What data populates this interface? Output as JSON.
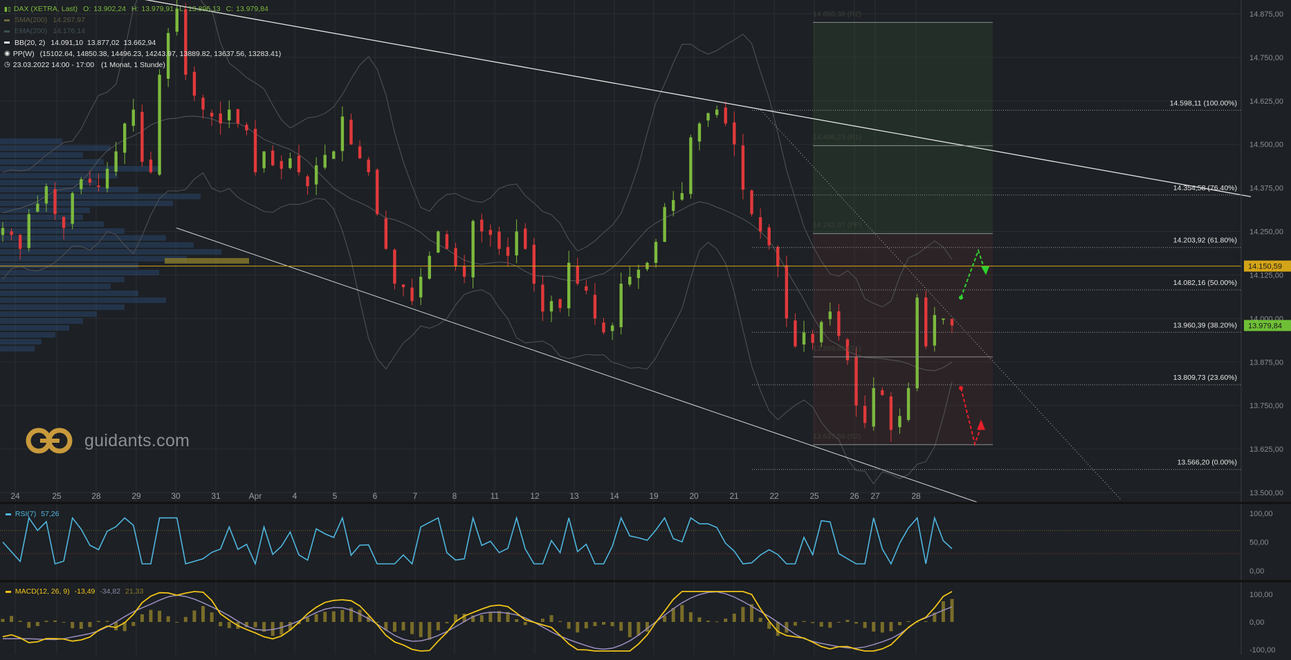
{
  "header": {
    "instrument_line": "DAX (XETRA, Last)",
    "ohlc": {
      "o_label": "O:",
      "o": "13.902,24",
      "h_label": "H:",
      "h": "13.979,91",
      "l_label": "L:",
      "l": "13.896,13",
      "c_label": "C:",
      "c": "13.979,84"
    },
    "sma": {
      "label": "SMA(200)",
      "value": "14.267,97"
    },
    "ema": {
      "label": "EMA(200)",
      "value": "14.176,14"
    },
    "bb": {
      "label": "BB(20, 2)",
      "values": "14.091,10  13.877,02  13.662,94"
    },
    "pp": {
      "label": "PP(W)",
      "values": "(15102.64, 14850.38, 14496.23, 14243.97, 13889.82, 13637.56, 13283.41)"
    },
    "time": {
      "label": "23.03.2022 14:00 - 17:00",
      "period": "(1 Monat, 1 Stunde)"
    }
  },
  "watermark": {
    "text": "guidants.com"
  },
  "colors": {
    "background": "#1d2024",
    "up": "#7cb93e",
    "down": "#e0393b",
    "line": "#e6e6e6",
    "price_line": "#d4a418",
    "current": "#6fbf36",
    "rsi": "#4fb6e0",
    "macd": "#f0c419",
    "signal": "#9b8fc2",
    "hist": "#8a7a2a",
    "target_up": "#2fd12f",
    "target_down": "#e8202a"
  },
  "main_axis": {
    "ticks": [
      "14.875,00",
      "14.750,00",
      "14.625,00",
      "14.500,00",
      "14.375,00",
      "14.250,00",
      "14.125,00",
      "14.000,00",
      "13.875,00",
      "13.750,00",
      "13.625,00",
      "13.500,00"
    ],
    "price_tag": "14.150,59",
    "last_tag": "13.979,84"
  },
  "x_axis_labels": [
    "24",
    "25",
    "28",
    "29",
    "30",
    "31",
    "Apr",
    "4",
    "5",
    "6",
    "7",
    "8",
    "11",
    "12",
    "13",
    "14",
    "19",
    "20",
    "21",
    "22",
    "25",
    "26",
    "27",
    "28"
  ],
  "fibonacci": [
    {
      "label": "14.598,11 (100.00%)",
      "value": 14598.11
    },
    {
      "label": "14.354,58 (76.40%)",
      "value": 14354.58
    },
    {
      "label": "14.203,92 (61.80%)",
      "value": 14203.92
    },
    {
      "label": "14.082,16 (50.00%)",
      "value": 14082.16
    },
    {
      "label": "13.960,39 (38.20%)",
      "value": 13960.39
    },
    {
      "label": "13.809,73 (23.60%)",
      "value": 13809.73
    },
    {
      "label": "13.566,20 (0.00%)",
      "value": 13566.2
    }
  ],
  "pivots": [
    {
      "label": "14.850,38 (R2)",
      "value": 14850.38
    },
    {
      "label": "14.496,23 (R1)",
      "value": 14496.23
    },
    {
      "label": "14.243,97 (PP)",
      "value": 14243.97
    },
    {
      "label": "13.889,82 (S1)",
      "value": 13889.82
    },
    {
      "label": "13.637,56 (S2)",
      "value": 13637.56
    }
  ],
  "rsi": {
    "label": "RSI(7)",
    "value": "57,26",
    "ticks": [
      "100,00",
      "50,00",
      "0,00"
    ],
    "upper": 70,
    "lower": 30
  },
  "macd": {
    "label": "MACD(12, 26, 9)",
    "macd": "-13,49",
    "signal": "-34,82",
    "hist": "21,33",
    "ticks": [
      "100,00",
      "0,00",
      "-100,00"
    ]
  },
  "chart_data": {
    "type": "candlestick",
    "title": "DAX (XETRA, Last)",
    "interval": "1 hour",
    "y_range": [
      13480,
      14925
    ],
    "x_session_labels": [
      "24",
      "25",
      "28",
      "29",
      "30",
      "31",
      "Apr",
      "4",
      "5",
      "6",
      "7",
      "8",
      "11",
      "12",
      "13",
      "14",
      "19",
      "20",
      "21",
      "22",
      "25",
      "26",
      "27",
      "28"
    ],
    "close_path": [
      14260,
      14240,
      14200,
      14300,
      14330,
      14380,
      14300,
      14260,
      14360,
      14400,
      14390,
      14380,
      14430,
      14480,
      14560,
      14600,
      14450,
      14420,
      14700,
      14820,
      14890,
      14700,
      14640,
      14600,
      14580,
      14560,
      14600,
      14560,
      14540,
      14420,
      14480,
      14440,
      14430,
      14460,
      14420,
      14380,
      14440,
      14470,
      14480,
      14580,
      14500,
      14460,
      14420,
      14300,
      14200,
      14100,
      14090,
      14050,
      14120,
      14180,
      14250,
      14200,
      14150,
      14120,
      14280,
      14250,
      14240,
      14200,
      14180,
      14250,
      14200,
      14100,
      14020,
      14050,
      14030,
      14160,
      14100,
      14080,
      14000,
      13960,
      13980,
      14100,
      14120,
      14140,
      14160,
      14220,
      14320,
      14340,
      14360,
      14520,
      14560,
      14590,
      14600,
      14560,
      14500,
      14370,
      14300,
      14250,
      14210,
      14150,
      14000,
      13920,
      13960,
      13930,
      13990,
      14020,
      13950,
      13880,
      13750,
      13700,
      13800,
      13780,
      13680,
      13720,
      13800,
      14060,
      13920,
      14010,
      14000,
      13980
    ],
    "resistance_trendline": [
      [
        0,
        14990
      ],
      [
        1808,
        14350
      ]
    ],
    "support_trendline": [
      [
        255,
        14260
      ],
      [
        1416,
        13470
      ]
    ],
    "horizontal_price": 14150.59,
    "last_price": 13979.84
  }
}
